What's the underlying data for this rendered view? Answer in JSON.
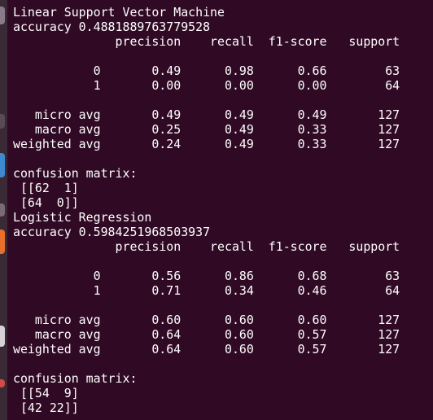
{
  "dock": {
    "icons": [
      {
        "name": "dock-icon-1",
        "color": "#8b7b8a"
      },
      {
        "name": "dock-icon-2",
        "color": "#5a4a55"
      },
      {
        "name": "dock-icon-3",
        "color": "#3d8ad1"
      },
      {
        "name": "dock-icon-4",
        "color": "#7a6a75"
      },
      {
        "name": "dock-icon-5",
        "color": "#e9702a"
      },
      {
        "name": "dock-icon-6",
        "color": "#d8d2d6"
      },
      {
        "name": "dock-icon-7",
        "color": "#d24a4a"
      }
    ]
  },
  "terminal": {
    "lines": [
      "Linear Support Vector Machine",
      "accuracy 0.4881889763779528",
      "              precision    recall  f1-score   support",
      "",
      "           0       0.49      0.98      0.66        63",
      "           1       0.00      0.00      0.00        64",
      "",
      "   micro avg       0.49      0.49      0.49       127",
      "   macro avg       0.25      0.49      0.33       127",
      "weighted avg       0.24      0.49      0.33       127",
      "",
      "confusion matrix:",
      " [[62  1]",
      " [64  0]]",
      "Logistic Regression",
      "accuracy 0.5984251968503937",
      "              precision    recall  f1-score   support",
      "",
      "           0       0.56      0.86      0.68        63",
      "           1       0.71      0.34      0.46        64",
      "",
      "   micro avg       0.60      0.60      0.60       127",
      "   macro avg       0.64      0.60      0.57       127",
      "weighted avg       0.64      0.60      0.57       127",
      "",
      "confusion matrix:",
      " [[54  9]",
      " [42 22]]"
    ]
  }
}
